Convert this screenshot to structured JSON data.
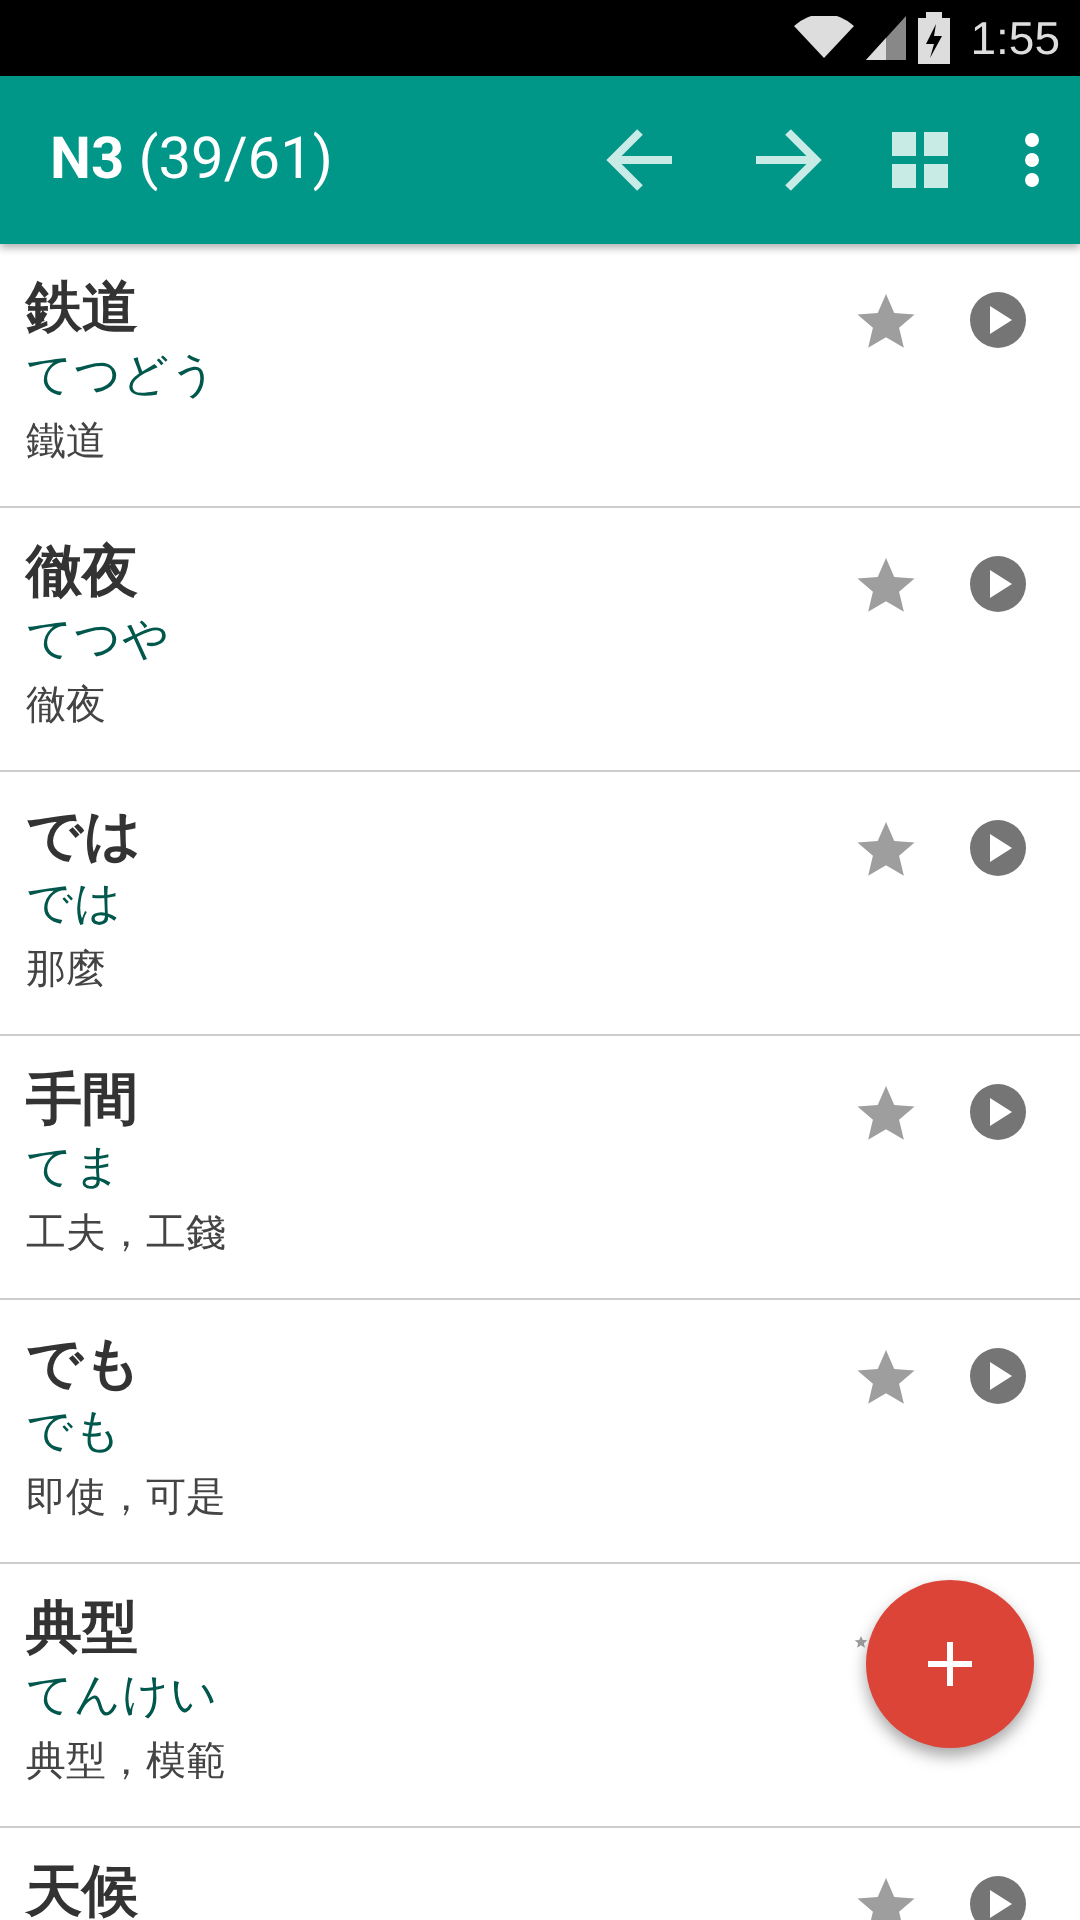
{
  "status_bar": {
    "time": "1:55"
  },
  "app_bar": {
    "title": "**N3** (39/61)"
  },
  "words": [
    {
      "kind": "plain",
      "word": "鉄道",
      "reading": "てつどう",
      "meaning": "鐵道"
    },
    {
      "kind": "plain",
      "word": "徹夜",
      "reading": "てつや",
      "meaning": "徹夜"
    },
    {
      "kind": "plain",
      "word": "では",
      "reading": "では",
      "meaning": "那麼"
    },
    {
      "kind": "plain",
      "word": "手間",
      "reading": "てま",
      "meaning": "工夫，工錢"
    },
    {
      "kind": "plain",
      "word": "でも",
      "reading": "でも",
      "meaning": "即使，可是"
    },
    {
      "kind": "covered",
      "word": "典型",
      "reading": "てんけい",
      "meaning": "典型，模範"
    },
    {
      "kind": "plain",
      "word": "天候"
    }
  ]
}
